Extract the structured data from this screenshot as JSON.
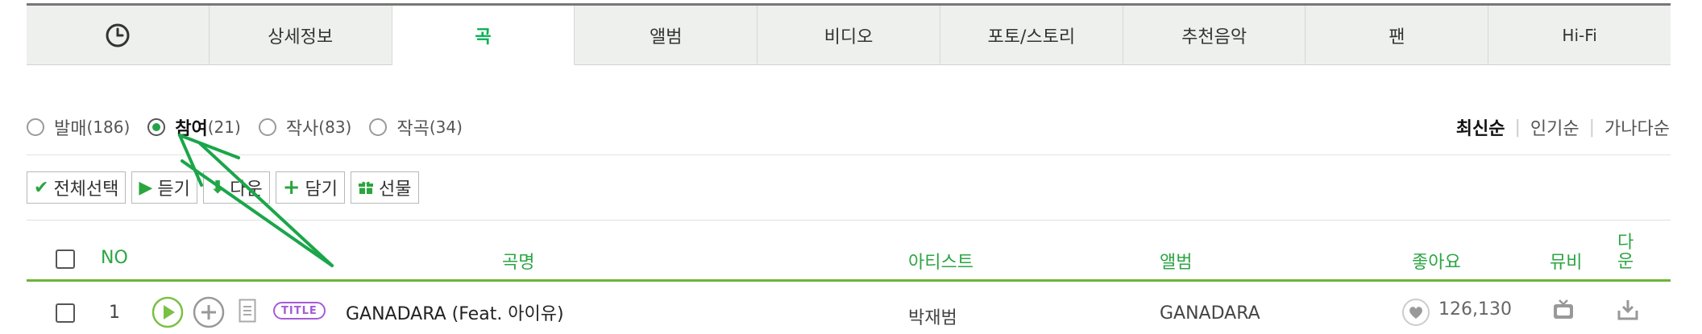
{
  "tabs": [
    {
      "label": "",
      "icon": "clock-icon"
    },
    {
      "label": "상세정보"
    },
    {
      "label": "곡"
    },
    {
      "label": "앨범"
    },
    {
      "label": "비디오"
    },
    {
      "label": "포토/스토리"
    },
    {
      "label": "추천음악"
    },
    {
      "label": "팬"
    },
    {
      "label": "Hi-Fi"
    }
  ],
  "active_tab": "곡",
  "filters": [
    {
      "label": "발매",
      "count": "(186)",
      "checked": false
    },
    {
      "label": "참여",
      "count": "(21)",
      "checked": true
    },
    {
      "label": "작사",
      "count": "(83)",
      "checked": false
    },
    {
      "label": "작곡",
      "count": "(34)",
      "checked": false
    }
  ],
  "sort": {
    "options": [
      "최신순",
      "인기순",
      "가나다순"
    ],
    "active": "최신순"
  },
  "toolbar": {
    "select_all": "전체선택",
    "listen": "듣기",
    "download": "다운",
    "add": "담기",
    "gift": "선물"
  },
  "table": {
    "headers": {
      "no": "NO",
      "song": "곡명",
      "artist": "아티스트",
      "album": "앨범",
      "like": "좋아요",
      "mv": "뮤비",
      "download": "다운"
    },
    "rows": [
      {
        "no": "1",
        "badge": "TITLE",
        "title": "GANADARA (Feat. 아이유)",
        "artist": "박재범",
        "album": "GANADARA",
        "likes": "126,130"
      }
    ]
  },
  "colors": {
    "accent_green": "#00b050",
    "header_green": "#2ca544",
    "title_badge_purple": "#a65bd6",
    "annotation_arrow": "#1aa64a"
  }
}
